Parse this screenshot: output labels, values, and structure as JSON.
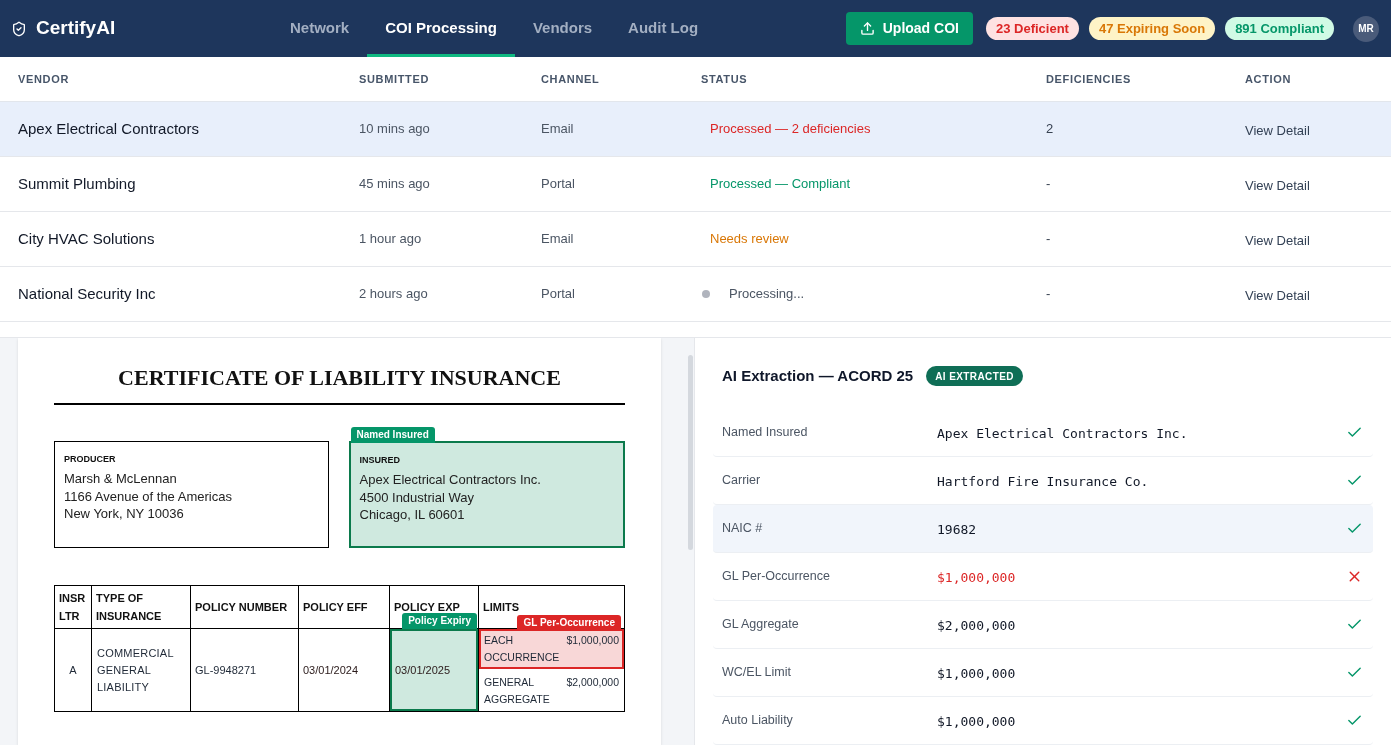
{
  "app": {
    "name": "CertifyAI"
  },
  "nav_tabs": [
    {
      "label": "Network",
      "selected": false
    },
    {
      "label": "COI Processing",
      "selected": true
    },
    {
      "label": "Vendors",
      "selected": false
    },
    {
      "label": "Audit Log",
      "selected": false
    }
  ],
  "upload_button": {
    "label": "Upload COI"
  },
  "summary_badges": [
    {
      "label": "23 Deficient",
      "kind": "danger"
    },
    {
      "label": "47 Expiring Soon",
      "kind": "warning"
    },
    {
      "label": "891 Compliant",
      "kind": "success"
    }
  ],
  "user": {
    "initials": "MR"
  },
  "submissions_table": {
    "columns": [
      "VENDOR",
      "SUBMITTED",
      "CHANNEL",
      "STATUS",
      "DEFICIENCIES",
      "ACTION"
    ],
    "rows": [
      {
        "vendor": "Apex Electrical Contractors",
        "submitted": "10 mins ago",
        "channel": "Email",
        "status": {
          "text": "Processed — 2 deficiencies",
          "kind": "deficient"
        },
        "deficiencies": "2",
        "action": "View Detail",
        "selected": true
      },
      {
        "vendor": "Summit Plumbing",
        "submitted": "45 mins ago",
        "channel": "Portal",
        "status": {
          "text": "Processed — Compliant",
          "kind": "compliant"
        },
        "deficiencies": "-",
        "action": "View Detail",
        "selected": false
      },
      {
        "vendor": "City HVAC Solutions",
        "submitted": "1 hour ago",
        "channel": "Email",
        "status": {
          "text": "Needs review",
          "kind": "review"
        },
        "deficiencies": "-",
        "action": "View Detail",
        "selected": false
      },
      {
        "vendor": "National Security Inc",
        "submitted": "2 hours ago",
        "channel": "Portal",
        "status": {
          "text": "Processing...",
          "kind": "processing"
        },
        "deficiencies": "-",
        "action": "View Detail",
        "selected": false
      }
    ]
  },
  "certificate": {
    "title": "CERTIFICATE OF LIABILITY INSURANCE",
    "producer": {
      "heading": "PRODUCER",
      "lines": [
        "Marsh & McLennan",
        "1166 Avenue of the Americas",
        "New York, NY 10036"
      ]
    },
    "insured": {
      "heading": "INSURED",
      "lines": [
        "Apex Electrical Contractors Inc.",
        "4500 Industrial Way",
        "Chicago, IL 60601"
      ],
      "verified": true,
      "tag": "Named Insured"
    },
    "coverage": {
      "columns": [
        "INSR LTR",
        "TYPE OF INSURANCE",
        "POLICY NUMBER",
        "POLICY EFF",
        "POLICY EXP",
        "LIMITS"
      ],
      "rows": [
        {
          "insr_ltr": "A",
          "type": "COMMERCIAL GENERAL LIABILITY",
          "policy_number": "GL-9948271",
          "policy_eff": "03/01/2024",
          "policy_exp": {
            "value": "03/01/2025",
            "verified": true,
            "tag": "Policy Expiry"
          },
          "limits": [
            {
              "label": "EACH OCCURRENCE",
              "amount": "$1,000,000",
              "flagged": true,
              "tag": "GL Per-Occurrence"
            },
            {
              "label": "GENERAL AGGREGATE",
              "amount": "$2,000,000",
              "flagged": false
            }
          ]
        }
      ]
    }
  },
  "extraction": {
    "title": "AI Extraction — ACORD 25",
    "badge": "AI EXTRACTED",
    "fields": [
      {
        "label": "Named Insured",
        "value": "Apex Electrical Contractors Inc.",
        "passed": true,
        "selected": false
      },
      {
        "label": "Carrier",
        "value": "Hartford Fire Insurance Co.",
        "passed": true,
        "selected": false
      },
      {
        "label": "NAIC #",
        "value": "19682",
        "passed": true,
        "selected": true
      },
      {
        "label": "GL Per-Occurrence",
        "value": "$1,000,000",
        "passed": false,
        "selected": false
      },
      {
        "label": "GL Aggregate",
        "value": "$2,000,000",
        "passed": true,
        "selected": false
      },
      {
        "label": "WC/EL Limit",
        "value": "$1,000,000",
        "passed": true,
        "selected": false
      },
      {
        "label": "Auto Liability",
        "value": "$1,000,000",
        "passed": true,
        "selected": false
      }
    ]
  }
}
